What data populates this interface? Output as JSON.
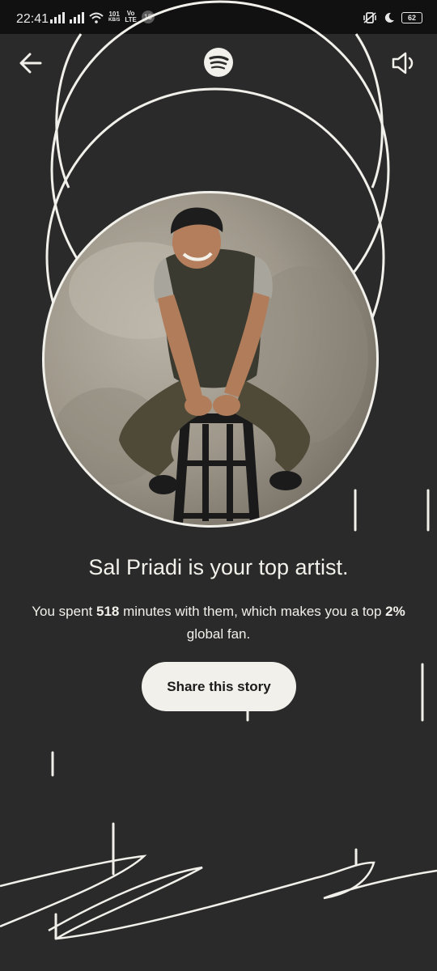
{
  "status_bar": {
    "time": "22:41",
    "net_speed_value": "101",
    "net_speed_unit": "KB/S",
    "volte_top": "Vo",
    "volte_bottom": "LTE",
    "notification_count": "15",
    "battery": "62"
  },
  "header": {
    "back_icon": "arrow-left-icon",
    "logo_icon": "spotify-logo-icon",
    "volume_icon": "volume-icon"
  },
  "story": {
    "headline": "Sal Priadi is your top artist.",
    "desc_part1": "You spent ",
    "minutes": "518",
    "desc_part2": " minutes with them, which makes you a top ",
    "percent": "2%",
    "desc_part3": " global fan.",
    "share_label": "Share this story"
  },
  "colors": {
    "background": "#2a2a2a",
    "foreground": "#f1f0ea",
    "status_bar": "#111111"
  }
}
